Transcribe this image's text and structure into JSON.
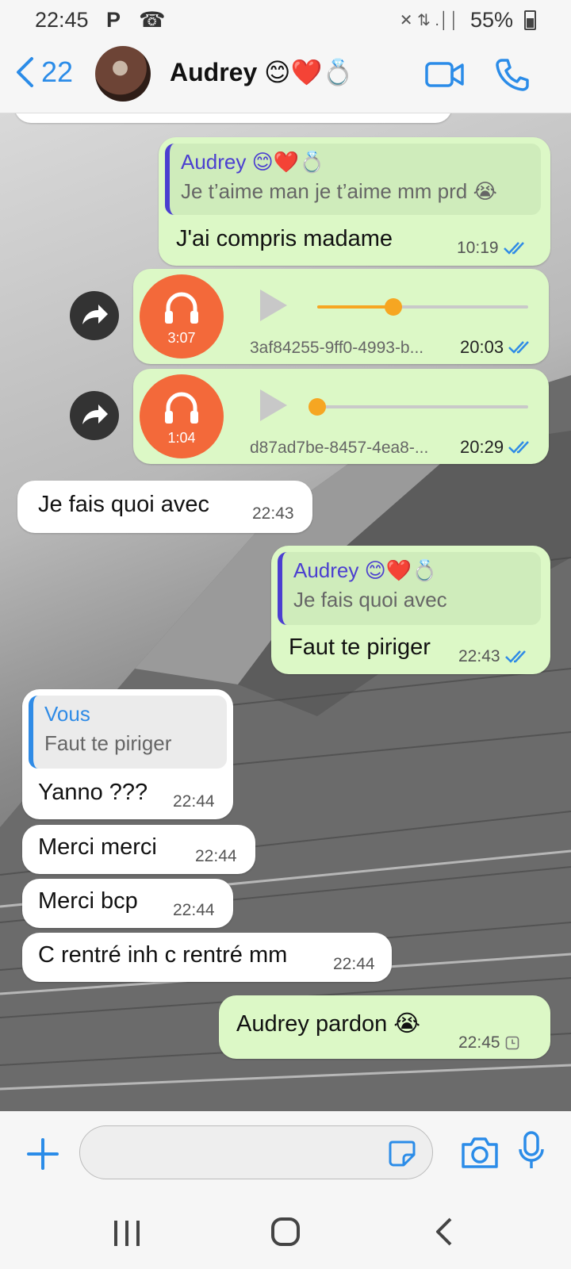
{
  "status_bar": {
    "time": "22:45",
    "left_icons": "P ☎",
    "battery": "55%",
    "right_icons": "✕ ⇅ .││"
  },
  "header": {
    "back_count": "22",
    "contact_name": "Audrey 😊❤️💍",
    "accent_color": "#2b8ce8"
  },
  "messages": [
    {
      "direction": "out",
      "reply_to": {
        "name": "Audrey 😊❤️💍",
        "text": "Je t’aime man je t’aime mm prd 😭"
      },
      "text": "J'ai compris madame",
      "time": "10:19",
      "status": "read"
    },
    {
      "direction": "out",
      "type": "audio",
      "duration": "3:07",
      "filename": "3af84255-9ff0-4993-b...",
      "progress": 0.36,
      "time": "20:03",
      "status": "read"
    },
    {
      "direction": "out",
      "type": "audio",
      "duration": "1:04",
      "filename": "d87ad7be-8457-4ea8-...",
      "progress": 0.0,
      "time": "20:29",
      "status": "read"
    },
    {
      "direction": "in",
      "text": "Je fais quoi avec",
      "time": "22:43"
    },
    {
      "direction": "out",
      "reply_to": {
        "name": "Audrey 😊❤️💍",
        "text": "Je fais quoi avec"
      },
      "text": "Faut te piriger",
      "time": "22:43",
      "status": "read"
    },
    {
      "direction": "in",
      "reply_to": {
        "name": "Vous",
        "text": "Faut te piriger"
      },
      "text": "Yanno ???",
      "time": "22:44"
    },
    {
      "direction": "in",
      "text": "Merci merci",
      "time": "22:44"
    },
    {
      "direction": "in",
      "text": "Merci bcp",
      "time": "22:44"
    },
    {
      "direction": "in",
      "text": "C rentré inh c rentré mm",
      "time": "22:44"
    },
    {
      "direction": "out",
      "text": "Audrey pardon 😭",
      "time": "22:45",
      "status": "pending"
    }
  ],
  "input": {
    "placeholder": ""
  },
  "colors": {
    "outgoing_bubble": "#dcf8c6",
    "incoming_bubble": "#ffffff",
    "audio_icon": "#f3693a",
    "audio_progress": "#f6a622",
    "read_ticks": "#2f8be6"
  }
}
